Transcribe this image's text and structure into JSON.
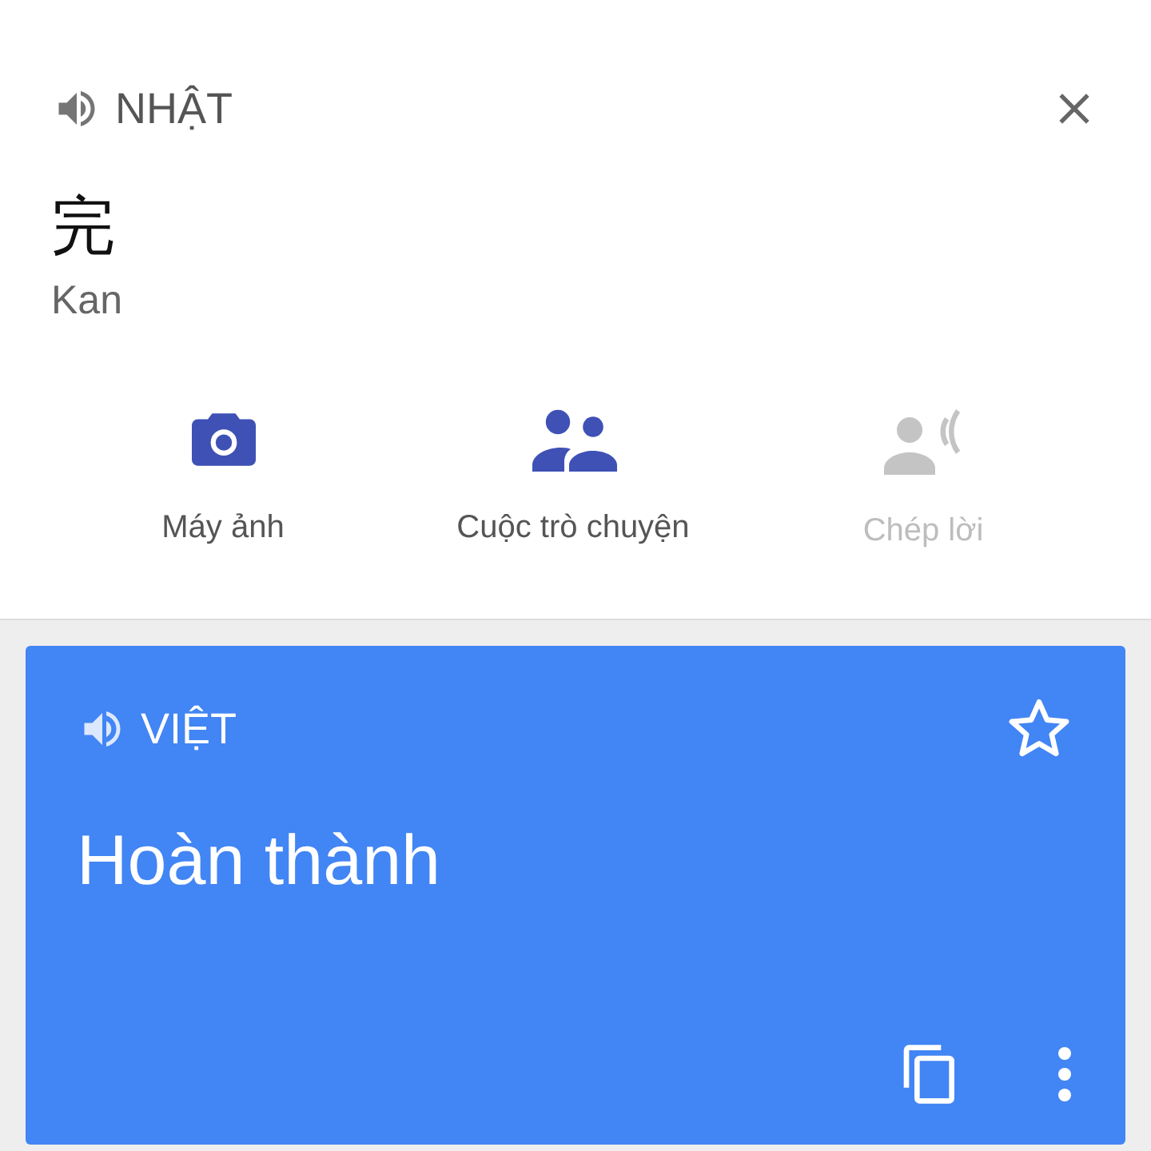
{
  "source": {
    "language": "NHẬT",
    "text": "完",
    "romanization": "Kan"
  },
  "actions": [
    {
      "kind": "camera",
      "label": "Máy ảnh",
      "disabled": false
    },
    {
      "kind": "conversation",
      "label": "Cuộc trò chuyện",
      "disabled": false
    },
    {
      "kind": "transcribe",
      "label": "Chép lời",
      "disabled": true
    }
  ],
  "result": {
    "language": "VIỆT",
    "text": "Hoàn thành",
    "starred": false
  }
}
